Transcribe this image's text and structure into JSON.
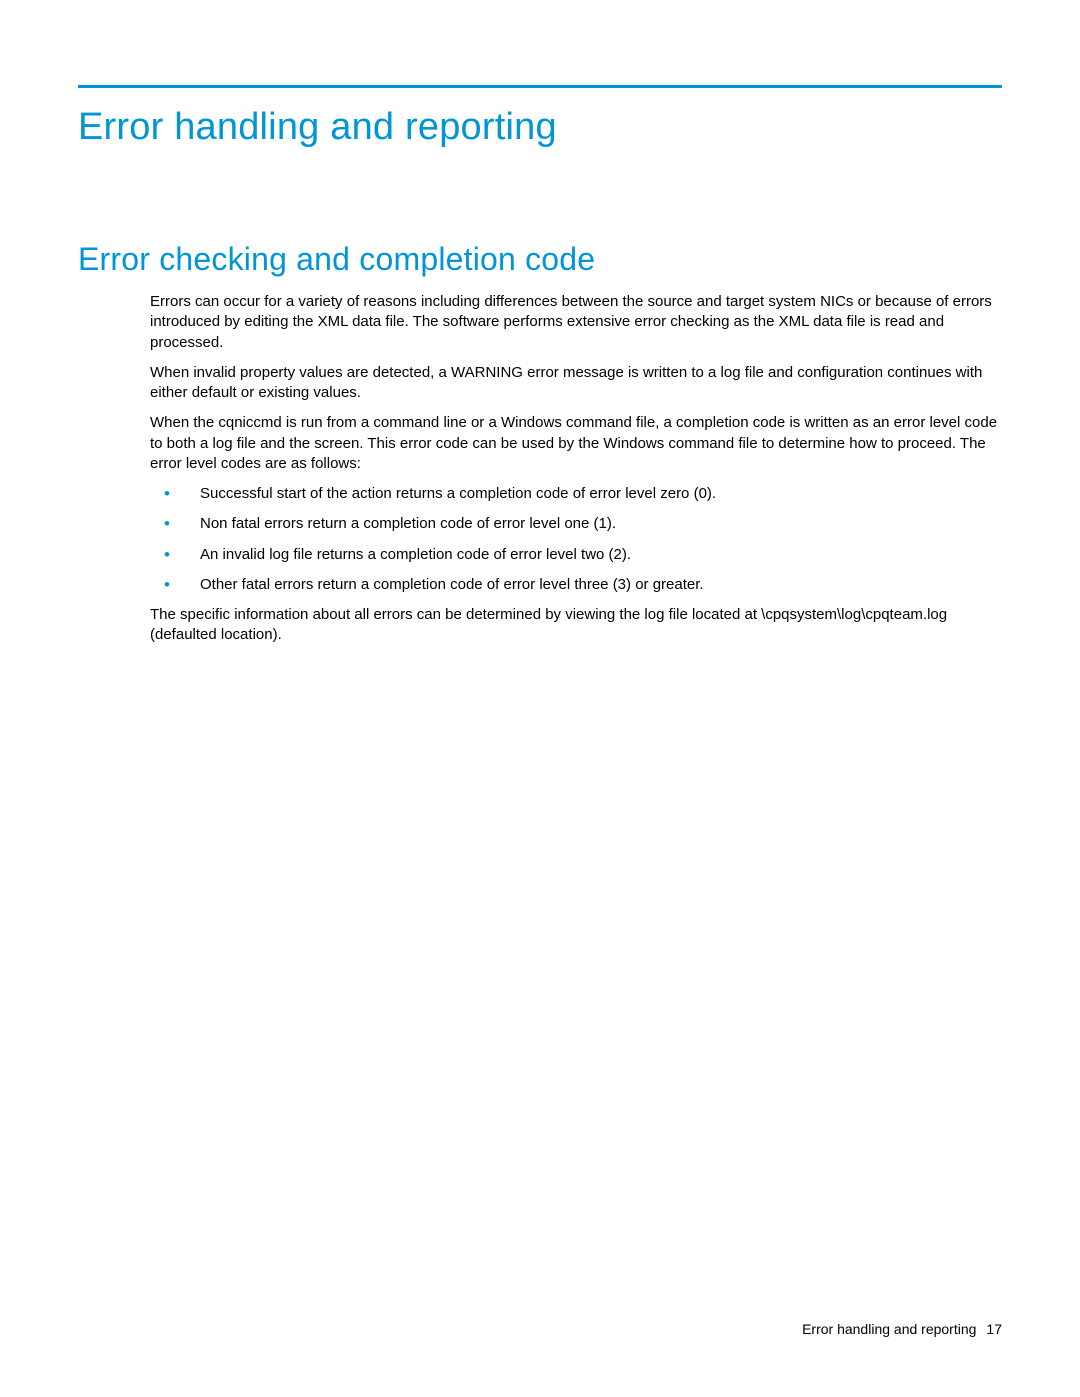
{
  "heading": {
    "main": "Error handling and reporting",
    "section": "Error checking and completion code"
  },
  "paragraphs": {
    "p1": "Errors can occur for a variety of reasons including differences between the source and target system NICs or because of errors introduced by editing the XML data file. The software performs extensive error checking as the XML data file is read and processed.",
    "p2": "When invalid property values are detected, a WARNING error message is written to a log file and configuration continues with either default or existing values.",
    "p3": "When the cqniccmd is run from a command line or a Windows command file, a completion code is written as an error level code to both a log file and the screen. This error code can be used by the Windows command file to determine how to proceed. The error level codes are as follows:",
    "p4": "The specific information about all errors can be determined by viewing the log file located at \\cpqsystem\\log\\cpqteam.log (defaulted location)."
  },
  "bullets": [
    "Successful start of the action returns a completion code of error level zero (0).",
    "Non fatal errors return a completion code of error level one (1).",
    "An invalid log file returns a completion code of error level two (2).",
    "Other fatal errors return a completion code of error level three (3) or greater."
  ],
  "footer": {
    "section_name": "Error handling and reporting",
    "page_number": "17"
  }
}
